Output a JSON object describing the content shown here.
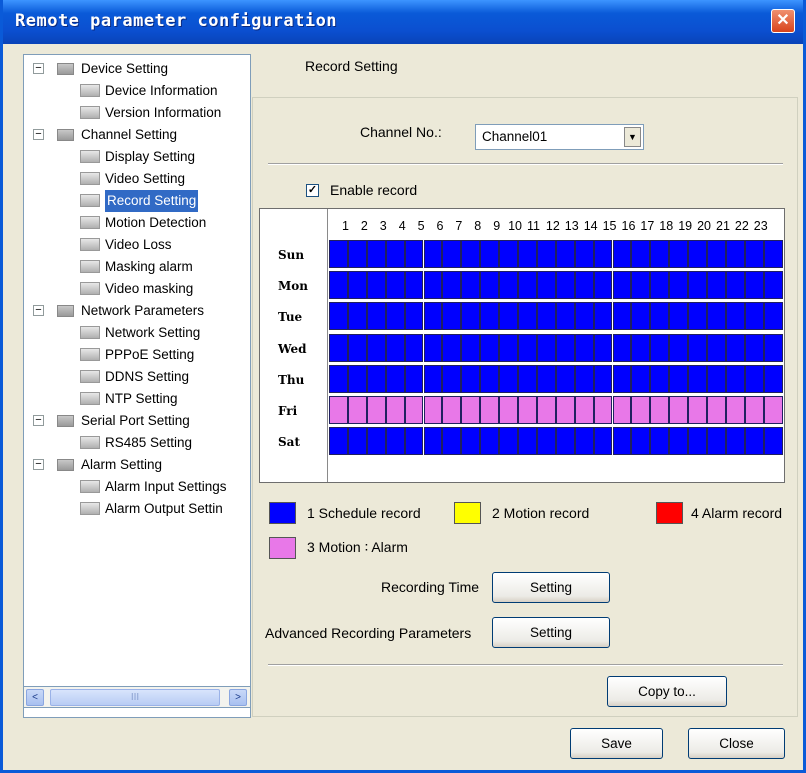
{
  "window": {
    "title": "Remote parameter configuration",
    "close_glyph": "✕"
  },
  "tree": [
    {
      "label": "Device Setting",
      "level": 0,
      "expander": "−"
    },
    {
      "label": "Device Information",
      "level": 1
    },
    {
      "label": "Version Information",
      "level": 1
    },
    {
      "label": "Channel Setting",
      "level": 0,
      "expander": "−"
    },
    {
      "label": "Display Setting",
      "level": 1
    },
    {
      "label": "Video Setting",
      "level": 1
    },
    {
      "label": "Record Setting",
      "level": 1,
      "selected": true
    },
    {
      "label": "Motion Detection",
      "level": 1
    },
    {
      "label": "Video Loss",
      "level": 1
    },
    {
      "label": "Masking alarm",
      "level": 1
    },
    {
      "label": "Video masking",
      "level": 1
    },
    {
      "label": "Network Parameters",
      "level": 0,
      "expander": "−"
    },
    {
      "label": "Network Setting",
      "level": 1
    },
    {
      "label": "PPPoE Setting",
      "level": 1
    },
    {
      "label": "DDNS Setting",
      "level": 1
    },
    {
      "label": "NTP Setting",
      "level": 1
    },
    {
      "label": "Serial Port Setting",
      "level": 0,
      "expander": "−"
    },
    {
      "label": "RS485 Setting",
      "level": 1
    },
    {
      "label": "Alarm Setting",
      "level": 0,
      "expander": "−"
    },
    {
      "label": "Alarm Input Settings",
      "level": 1
    },
    {
      "label": "Alarm Output Settin",
      "level": 1
    }
  ],
  "scrollbar": {
    "left_glyph": "<",
    "right_glyph": ">",
    "thumb_glyph": "III"
  },
  "main": {
    "section_title": "Record Setting",
    "channel_label": "Channel No.:",
    "channel_value": "Channel01",
    "dropdown_glyph": "▼",
    "enable_record_label": "Enable record",
    "enable_record_checked": true,
    "check_glyph": "✓"
  },
  "schedule": {
    "hours": [
      "1",
      "2",
      "3",
      "4",
      "5",
      "6",
      "7",
      "8",
      "9",
      "10",
      "11",
      "12",
      "13",
      "14",
      "15",
      "16",
      "17",
      "18",
      "19",
      "20",
      "21",
      "22",
      "23"
    ],
    "days": [
      "Sun",
      "Mon",
      "Tue",
      "Wed",
      "Thu",
      "Fri",
      "Sat"
    ],
    "day_modes": [
      1,
      1,
      1,
      1,
      1,
      3,
      1
    ],
    "mode_colors": {
      "1": "#0000ff",
      "2": "#ffff00",
      "3": "#e878e8",
      "4": "#ff0000"
    }
  },
  "legend": [
    {
      "label": "1 Schedule record",
      "color": "#0000ff"
    },
    {
      "label": "2 Motion record",
      "color": "#ffff00"
    },
    {
      "label": "4 Alarm record",
      "color": "#ff0000"
    },
    {
      "label": "3 Motion ∶ Alarm",
      "color": "#e878e8"
    }
  ],
  "recording_time": {
    "label": "Recording Time",
    "button": "Setting"
  },
  "advanced": {
    "label": "Advanced Recording Parameters",
    "button": "Setting"
  },
  "buttons": {
    "copy": "Copy to...",
    "save": "Save",
    "close": "Close"
  }
}
